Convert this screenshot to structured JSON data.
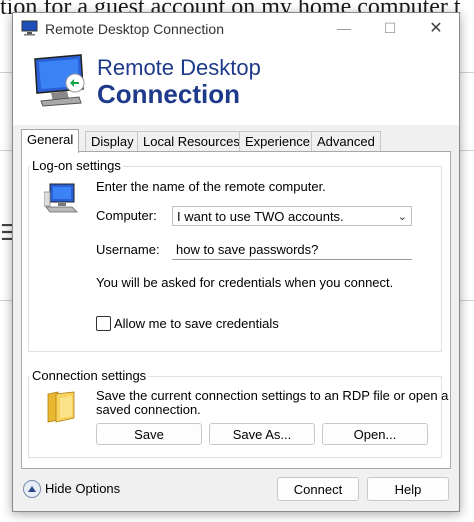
{
  "background": {
    "headline": "tion for a guest account on my home computer t"
  },
  "window": {
    "title": "Remote Desktop Connection",
    "header_line1": "Remote Desktop",
    "header_line2": "Connection",
    "controls": {
      "minimize": "—",
      "maximize": "☐",
      "close": "✕"
    }
  },
  "tabs": [
    {
      "label": "General",
      "active": true
    },
    {
      "label": "Display"
    },
    {
      "label": "Local Resources"
    },
    {
      "label": "Experience"
    },
    {
      "label": "Advanced"
    }
  ],
  "logon": {
    "group_label": "Log-on settings",
    "intro": "Enter the name of the remote computer.",
    "computer_label": "Computer:",
    "computer_value": "I want to use TWO accounts.",
    "username_label": "Username:",
    "username_value": "how to save passwords?",
    "credentials_note": "You will be asked for credentials when you connect.",
    "allow_save_label": "Allow me to save credentials",
    "allow_save_checked": false
  },
  "connection": {
    "group_label": "Connection settings",
    "description_line1": "Save the current connection settings to an RDP file or open a",
    "description_line2": "saved connection.",
    "save_label": "Save",
    "save_as_label": "Save As...",
    "open_label": "Open..."
  },
  "footer": {
    "hide_options_label": "Hide Options",
    "connect_label": "Connect",
    "help_label": "Help"
  },
  "colors": {
    "header_blue": "#1e3a8a",
    "dialog_bg": "#f0f0f0",
    "panel_bg": "#ffffff"
  }
}
